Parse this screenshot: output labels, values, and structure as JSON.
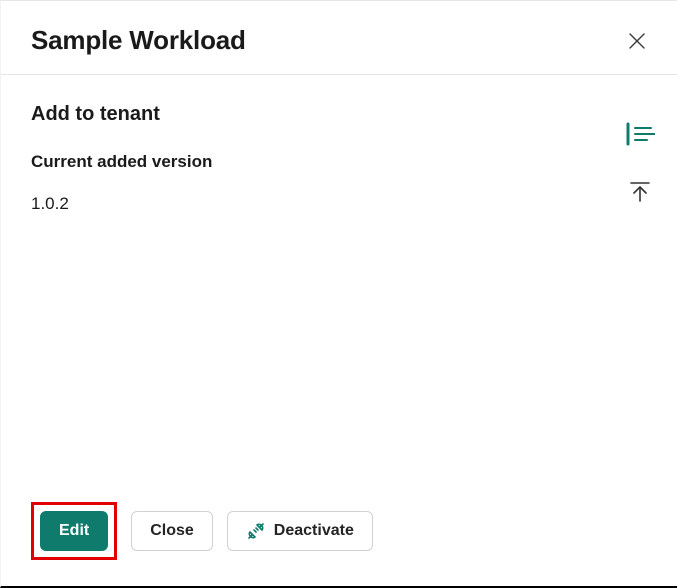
{
  "header": {
    "title": "Sample Workload"
  },
  "section": {
    "title": "Add to tenant",
    "version_label": "Current added version",
    "version_value": "1.0.2"
  },
  "actions": {
    "edit": "Edit",
    "close": "Close",
    "deactivate": "Deactivate"
  },
  "colors": {
    "accent": "#0F7B6C",
    "highlight": "#e20000"
  }
}
